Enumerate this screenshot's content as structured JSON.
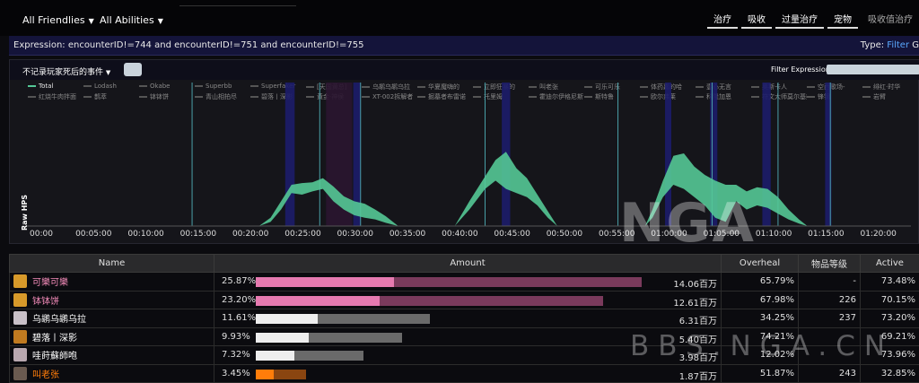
{
  "header": {
    "friendlies": "All Friendlies",
    "abilities": "All Abilities",
    "view_tabs": [
      "治疗",
      "吸收",
      "过量治疗",
      "宠物"
    ],
    "view_extra": "吸收值治疗",
    "expression_label": "Expression: encounterID!=744 and encounterID!=751 and encounterID!=755",
    "type_label": "Type:",
    "type_value": "Filter",
    "type_extra": "G"
  },
  "filters": {
    "events_select": "不记录玩家死后的事件",
    "filter_expression_label": "Filter Expression:"
  },
  "legend": {
    "row1": [
      "Total",
      "Lodash",
      "Okabe",
      "Superbb",
      "Superfaker",
      "[天国黄总]",
      "乌鹕乌鹕乌拉",
      "华夏魔嗨的",
      "立即狂暴的",
      "叫老张",
      "可乐可乐",
      "体药嘉的哈",
      "壹心无言",
      "奥斯卡人",
      "空西歌场-",
      "绯红·时华",
      "快乐灵魂",
      "流浪流浪",
      "搞搞咗"
    ],
    "row2": [
      "红烧牛肉拌面",
      "鹊萃",
      "钵钵饼",
      "青山相拍尽",
      "碧落丨深影",
      "黄金·神侯",
      "XT-002拆解者",
      "掘墓者布雷诺",
      "托里姆",
      "霍迪尔伊格尼斯",
      "斯特鲁",
      "欧尔弗莱",
      "科隆加恩",
      "符文大师莫尔基姆",
      "锋钢",
      "岩臂",
      "拆解者之心",
      "远征军财务总"
    ]
  },
  "chart_data": {
    "type": "area",
    "ylabel": "Raw HPS",
    "x_ticks": [
      "00:00",
      "00:05:00",
      "00:10:00",
      "00:15:00",
      "00:20:00",
      "00:25:00",
      "00:30:00",
      "00:35:00",
      "00:40:00",
      "00:45:00",
      "00:50:00",
      "00:55:00",
      "01:00:00",
      "01:05:00",
      "01:10:00",
      "01:15:00",
      "01:20:00"
    ],
    "x_range_min": [
      0,
      82
    ],
    "y_range_relative": [
      0,
      1.0
    ],
    "series": [
      {
        "name": "Total",
        "color": "#54c896",
        "points_min": [
          [
            20.9,
            0
          ],
          [
            22.5,
            0.2
          ],
          [
            24,
            0.35
          ],
          [
            25,
            0.5
          ],
          [
            26,
            0.52
          ],
          [
            27,
            0.55
          ],
          [
            28,
            0.52
          ],
          [
            29,
            0.32
          ],
          [
            30,
            0.2
          ],
          [
            31,
            0.15
          ],
          [
            32,
            0.2
          ],
          [
            33,
            0.12
          ],
          [
            34,
            0.0
          ]
        ],
        "upper_min": [
          [
            20.9,
            0
          ],
          [
            22.5,
            0.18
          ],
          [
            24,
            0.45
          ],
          [
            25,
            0.55
          ],
          [
            26,
            0.55
          ],
          [
            27,
            0.6
          ],
          [
            28,
            0.5
          ],
          [
            29,
            0.35
          ],
          [
            30,
            0.25
          ],
          [
            31,
            0.24
          ],
          [
            32,
            0.18
          ],
          [
            33,
            0.12
          ],
          [
            34,
            0
          ]
        ]
      }
    ],
    "peaks": [
      {
        "start_min": 20.9,
        "end_min": 34.2,
        "upper": [
          [
            20.9,
            0
          ],
          [
            22,
            0.1
          ],
          [
            23,
            0.3
          ],
          [
            24,
            0.5
          ],
          [
            25,
            0.52
          ],
          [
            26,
            0.53
          ],
          [
            27,
            0.58
          ],
          [
            28,
            0.48
          ],
          [
            29,
            0.36
          ],
          [
            30,
            0.3
          ],
          [
            31,
            0.27
          ],
          [
            32,
            0.2
          ],
          [
            33,
            0.12
          ],
          [
            34.2,
            0
          ]
        ],
        "lower": [
          [
            20.9,
            0
          ],
          [
            22,
            0.05
          ],
          [
            23,
            0.2
          ],
          [
            24,
            0.4
          ],
          [
            25,
            0.38
          ],
          [
            26,
            0.42
          ],
          [
            27,
            0.45
          ],
          [
            28,
            0.3
          ],
          [
            29,
            0.2
          ],
          [
            30,
            0.13
          ],
          [
            31,
            0.1
          ],
          [
            32,
            0.08
          ],
          [
            33,
            0.04
          ],
          [
            34.2,
            0
          ]
        ]
      },
      {
        "start_min": 39.6,
        "end_min": 49.4,
        "upper": [
          [
            39.6,
            0
          ],
          [
            41,
            0.3
          ],
          [
            42.5,
            0.6
          ],
          [
            43.5,
            0.8
          ],
          [
            44.5,
            0.9
          ],
          [
            45.5,
            0.7
          ],
          [
            46.5,
            0.58
          ],
          [
            47.5,
            0.38
          ],
          [
            48.5,
            0.18
          ],
          [
            49.4,
            0
          ]
        ],
        "lower": [
          [
            39.6,
            0
          ],
          [
            41,
            0.2
          ],
          [
            42.5,
            0.45
          ],
          [
            43.5,
            0.55
          ],
          [
            44.5,
            0.45
          ],
          [
            45.5,
            0.4
          ],
          [
            46.5,
            0.35
          ],
          [
            47.5,
            0.25
          ],
          [
            48.5,
            0.1
          ],
          [
            49.4,
            0
          ]
        ]
      },
      {
        "start_min": 57.8,
        "end_min": 73.3,
        "upper": [
          [
            57.8,
            0
          ],
          [
            58.5,
            0.2
          ],
          [
            59.5,
            0.55
          ],
          [
            60.5,
            0.85
          ],
          [
            61.5,
            0.88
          ],
          [
            62.5,
            0.72
          ],
          [
            63.5,
            0.62
          ],
          [
            64.5,
            0.55
          ],
          [
            65.5,
            0.5
          ],
          [
            66.5,
            0.5
          ],
          [
            67.5,
            0.42
          ],
          [
            68.5,
            0.47
          ],
          [
            69.5,
            0.45
          ],
          [
            70.5,
            0.35
          ],
          [
            71.5,
            0.2
          ],
          [
            72.5,
            0.08
          ],
          [
            73.3,
            0
          ]
        ],
        "lower": [
          [
            57.8,
            0
          ],
          [
            58.5,
            0.1
          ],
          [
            59.5,
            0.35
          ],
          [
            60.5,
            0.5
          ],
          [
            61.5,
            0.45
          ],
          [
            62.5,
            0.35
          ],
          [
            63.5,
            0.25
          ],
          [
            64.5,
            0.1
          ],
          [
            65.5,
            0.05
          ],
          [
            66.5,
            0.3
          ],
          [
            67.5,
            0.2
          ],
          [
            68.5,
            0.25
          ],
          [
            69.5,
            0.22
          ],
          [
            70.5,
            0.15
          ],
          [
            71.5,
            0.08
          ],
          [
            72.5,
            0.03
          ],
          [
            73.3,
            0
          ]
        ]
      }
    ],
    "markers_min": [
      14.5,
      26.7,
      30.6,
      42.5,
      55.2,
      64.2,
      70.5,
      75.5
    ],
    "bands_min": [
      [
        23.4,
        24.3
      ],
      [
        27.3,
        29.8
      ],
      [
        29.9,
        30.6
      ],
      [
        44.1,
        44.9
      ],
      [
        59.7,
        60.3
      ],
      [
        64.0,
        64.7
      ],
      [
        69.0,
        69.8
      ],
      [
        75.0,
        75.6
      ]
    ]
  },
  "table": {
    "columns": [
      "Name",
      "Amount",
      "Overheal",
      "物品等级",
      "Active"
    ],
    "rows": [
      {
        "name": "可樂可樂",
        "name_color": "#f48cba",
        "pct": "25.87%",
        "pct_num": 25.87,
        "bar_color": "#e67ab0",
        "bar_track": "#7a3a5c",
        "bar_total": 1.0,
        "amount": "14.06百万",
        "overheal": "65.79%",
        "ilvl": "-",
        "active": "73.48%",
        "avatar": "#d89a2a"
      },
      {
        "name": "钵钵饼",
        "name_color": "#f48cba",
        "pct": "23.20%",
        "pct_num": 23.2,
        "bar_color": "#e67ab0",
        "bar_track": "#7a3a5c",
        "bar_total": 0.9,
        "amount": "12.61百万",
        "overheal": "67.98%",
        "ilvl": "226",
        "active": "70.15%",
        "avatar": "#d89a2a"
      },
      {
        "name": "乌鹕乌鹕乌拉",
        "name_color": "#ffffff",
        "pct": "11.61%",
        "pct_num": 11.61,
        "bar_color": "#eeeeee",
        "bar_track": "#6a6a6a",
        "bar_total": 0.45,
        "amount": "6.31百万",
        "overheal": "34.25%",
        "ilvl": "237",
        "active": "73.20%",
        "avatar": "#c9c0c8"
      },
      {
        "name": "碧落丨深影",
        "name_color": "#ffffff",
        "pct": "9.93%",
        "pct_num": 9.93,
        "bar_color": "#eeeeee",
        "bar_track": "#6a6a6a",
        "bar_total": 0.38,
        "amount": "5.40百万",
        "overheal": "74.21%",
        "ilvl": "",
        "active": "69.21%",
        "avatar": "#c07a20"
      },
      {
        "name": "哇莳蘇師咆",
        "name_color": "#ffffff",
        "pct": "7.32%",
        "pct_num": 7.32,
        "bar_color": "#eeeeee",
        "bar_track": "#6a6a6a",
        "bar_total": 0.28,
        "amount": "3.98百万",
        "overheal": "12.02%",
        "ilvl": "",
        "active": "73.96%",
        "avatar": "#b9a8b0"
      },
      {
        "name": "叫老张",
        "name_color": "#ff7d0a",
        "pct": "3.45%",
        "pct_num": 3.45,
        "bar_color": "#ff7d0a",
        "bar_track": "#8a4510",
        "bar_total": 0.13,
        "amount": "1.87百万",
        "overheal": "51.87%",
        "ilvl": "243",
        "active": "32.85%",
        "avatar": "#6a5a50"
      }
    ]
  },
  "watermark": {
    "logo": "NGA",
    "site": "BBS.NGA.CN"
  }
}
